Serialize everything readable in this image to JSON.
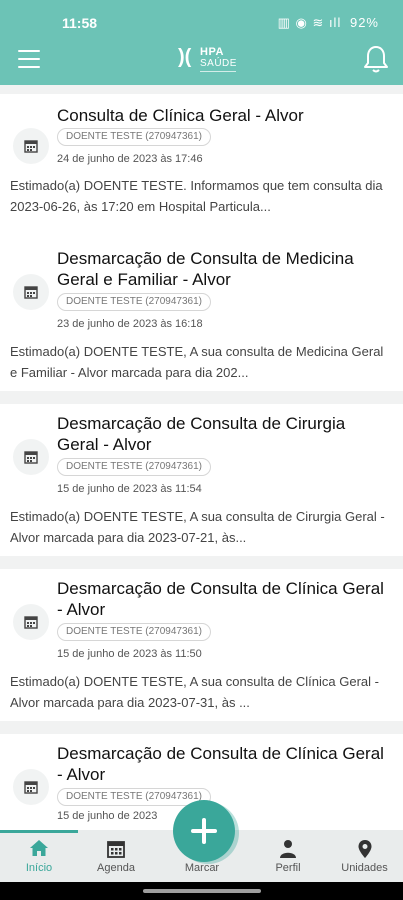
{
  "status_bar": {
    "time": "11:58",
    "icons": "▥ ◉ ≋ ıll",
    "battery": "92%"
  },
  "header": {
    "logo_mark": ")(",
    "logo_top": "HPA",
    "logo_bottom": "SAÚDE"
  },
  "notifications": [
    {
      "title": "Consulta de Clínica Geral - Alvor",
      "badge": "DOENTE TESTE (270947361)",
      "date": "24 de junho de 2023 às 17:46",
      "message": "Estimado(a) DOENTE TESTE. Informamos que tem consulta dia 2023-06-26, às 17:20 em Hospital Particula..."
    },
    {
      "title": "Desmarcação de Consulta de Medicina Geral e Familiar - Alvor",
      "badge": "DOENTE TESTE (270947361)",
      "date": "23 de junho de 2023 às 16:18",
      "message": "Estimado(a) DOENTE TESTE, A sua consulta de Medicina Geral e Familiar - Alvor marcada para dia  202..."
    },
    {
      "title": "Desmarcação de Consulta de Cirurgia Geral - Alvor",
      "badge": "DOENTE TESTE (270947361)",
      "date": "15 de junho de 2023 às 11:54",
      "message": "Estimado(a) DOENTE TESTE, A sua consulta de Cirurgia Geral - Alvor marcada para dia  2023-07-21, às..."
    },
    {
      "title": "Desmarcação de Consulta de Clínica Geral - Alvor",
      "badge": "DOENTE TESTE (270947361)",
      "date": "15 de junho de 2023 às 11:50",
      "message": "Estimado(a) DOENTE TESTE, A sua consulta de Clínica Geral - Alvor marcada para dia  2023-07-31, às ..."
    },
    {
      "title": "Desmarcação de Consulta de Clínica Geral - Alvor",
      "badge": "DOENTE TESTE (270947361)",
      "date": "15 de junho de 2023",
      "message": ""
    }
  ],
  "bottom_nav": {
    "items": [
      {
        "label": "Início",
        "icon": "home-icon",
        "active": true
      },
      {
        "label": "Agenda",
        "icon": "calendar-icon",
        "active": false
      },
      {
        "label": "Marcar",
        "icon": "plus-icon",
        "active": false
      },
      {
        "label": "Perfil",
        "icon": "person-icon",
        "active": false
      },
      {
        "label": "Unidades",
        "icon": "location-pin-icon",
        "active": false
      }
    ]
  },
  "colors": {
    "brand": "#6cc3b6",
    "accent": "#3aa79a"
  }
}
